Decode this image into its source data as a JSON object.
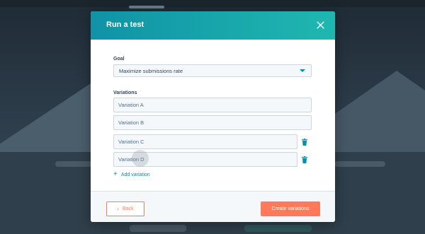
{
  "modal": {
    "title": "Run a test",
    "goal": {
      "label": "Goal",
      "selected": "Maximize submissions rate"
    },
    "variations": {
      "label": "Variations",
      "items": [
        {
          "value": "Variation A",
          "deletable": false
        },
        {
          "value": "Variation B",
          "deletable": false
        },
        {
          "value": "Variation C",
          "deletable": true
        },
        {
          "value": "Variation D",
          "deletable": true
        }
      ],
      "add_label": "Add variation"
    },
    "footer": {
      "back_label": "Back",
      "create_label": "Create variations"
    }
  },
  "colors": {
    "header_start": "#0f93a6",
    "header_end": "#20b7b0",
    "accent_orange": "#ff7a59",
    "link_teal": "#0091ae"
  },
  "icons": {
    "close": "close-icon",
    "caret": "caret-down-icon",
    "trash": "trash-icon",
    "plus": "plus-icon",
    "back": "chevron-left-icon"
  }
}
